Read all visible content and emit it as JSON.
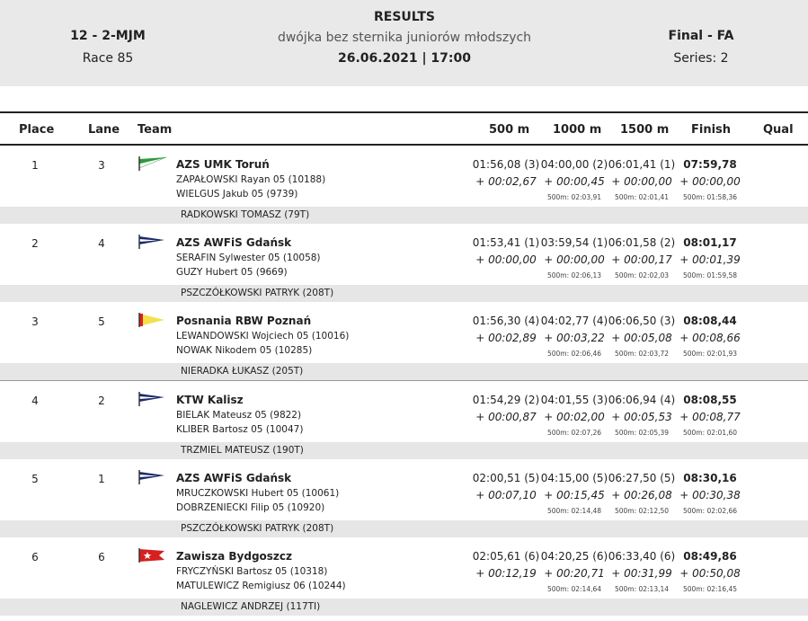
{
  "header": {
    "event_code": "12 - 2-MJM",
    "race": "Race 85",
    "title": "RESULTS",
    "subtitle": "dwójka bez sternika juniorów młodszych",
    "datetime": "26.06.2021 | 17:00",
    "phase": "Final - FA",
    "series": "Series: 2"
  },
  "columns": {
    "place": "Place",
    "lane": "Lane",
    "team": "Team",
    "s500": "500 m",
    "s1000": "1000 m",
    "s1500": "1500 m",
    "finish": "Finish",
    "qual": "Qual"
  },
  "rows": [
    {
      "place": "1",
      "lane": "3",
      "team": "AZS UMK Toruń",
      "rower1": "ZAPAŁOWSKI  Rayan 05 (10188)",
      "rower2": "WIELGUS  Jakub 05 (9739)",
      "cox": "RADKOWSKI TOMASZ (79T)",
      "flag_icon": "flag-green-white-icon",
      "splits": [
        {
          "time": "01:56,08 (3)",
          "delta": "+ 00:02,67",
          "pace": ""
        },
        {
          "time": "04:00,00 (2)",
          "delta": "+ 00:00,45",
          "pace": "500m: 02:03,91"
        },
        {
          "time": "06:01,41 (1)",
          "delta": "+ 00:00,00",
          "pace": "500m: 02:01,41"
        },
        {
          "time": "07:59,78",
          "delta": "+ 00:00,00",
          "pace": "500m: 01:58,36"
        }
      ]
    },
    {
      "place": "2",
      "lane": "4",
      "team": "AZS AWFiS Gdańsk",
      "rower1": "SERAFIN  Sylwester 05 (10058)",
      "rower2": "GUZY  Hubert 05 (9669)",
      "cox": "PSZCZÓŁKOWSKI PATRYK (208T)",
      "flag_icon": "flag-navy-white-icon",
      "splits": [
        {
          "time": "01:53,41 (1)",
          "delta": "+ 00:00,00",
          "pace": ""
        },
        {
          "time": "03:59,54 (1)",
          "delta": "+ 00:00,00",
          "pace": "500m: 02:06,13"
        },
        {
          "time": "06:01,58 (2)",
          "delta": "+ 00:00,17",
          "pace": "500m: 02:02,03"
        },
        {
          "time": "08:01,17",
          "delta": "+ 00:01,39",
          "pace": "500m: 01:59,58"
        }
      ]
    },
    {
      "place": "3",
      "lane": "5",
      "team": "Posnania RBW Poznań",
      "rower1": "LEWANDOWSKI  Wojciech 05 (10016)",
      "rower2": "NOWAK  Nikodem 05 (10285)",
      "cox": "NIERADKA ŁUKASZ (205T)",
      "flag_icon": "flag-yellow-red-icon",
      "splits": [
        {
          "time": "01:56,30 (4)",
          "delta": "+ 00:02,89",
          "pace": ""
        },
        {
          "time": "04:02,77 (4)",
          "delta": "+ 00:03,22",
          "pace": "500m: 02:06,46"
        },
        {
          "time": "06:06,50 (3)",
          "delta": "+ 00:05,08",
          "pace": "500m: 02:03,72"
        },
        {
          "time": "08:08,44",
          "delta": "+ 00:08,66",
          "pace": "500m: 02:01,93"
        }
      ]
    },
    {
      "place": "4",
      "lane": "2",
      "team": "KTW Kalisz",
      "rower1": "BIELAK  Mateusz 05 (9822)",
      "rower2": "KLIBER  Bartosz 05 (10047)",
      "cox": "TRZMIEL MATEUSZ (190T)",
      "flag_icon": "flag-navy-white-icon",
      "splits": [
        {
          "time": "01:54,29 (2)",
          "delta": "+ 00:00,87",
          "pace": ""
        },
        {
          "time": "04:01,55 (3)",
          "delta": "+ 00:02,00",
          "pace": "500m: 02:07,26"
        },
        {
          "time": "06:06,94 (4)",
          "delta": "+ 00:05,53",
          "pace": "500m: 02:05,39"
        },
        {
          "time": "08:08,55",
          "delta": "+ 00:08,77",
          "pace": "500m: 02:01,60"
        }
      ]
    },
    {
      "place": "5",
      "lane": "1",
      "team": "AZS AWFiS Gdańsk",
      "rower1": "MRUCZKOWSKI  Hubert 05 (10061)",
      "rower2": "DOBRZENIECKI  Filip 05 (10920)",
      "cox": "PSZCZÓŁKOWSKI PATRYK (208T)",
      "flag_icon": "flag-navy-white-icon",
      "splits": [
        {
          "time": "02:00,51 (5)",
          "delta": "+ 00:07,10",
          "pace": ""
        },
        {
          "time": "04:15,00 (5)",
          "delta": "+ 00:15,45",
          "pace": "500m: 02:14,48"
        },
        {
          "time": "06:27,50 (5)",
          "delta": "+ 00:26,08",
          "pace": "500m: 02:12,50"
        },
        {
          "time": "08:30,16",
          "delta": "+ 00:30,38",
          "pace": "500m: 02:02,66"
        }
      ]
    },
    {
      "place": "6",
      "lane": "6",
      "team": "Zawisza Bydgoszcz",
      "rower1": "FRYCZYŃSKI  Bartosz 05 (10318)",
      "rower2": "MATULEWICZ  Remigiusz 06 (10244)",
      "cox": "NAGLEWICZ ANDRZEJ (117TI)",
      "flag_icon": "flag-red-white-star-icon",
      "splits": [
        {
          "time": "02:05,61 (6)",
          "delta": "+ 00:12,19",
          "pace": ""
        },
        {
          "time": "04:20,25 (6)",
          "delta": "+ 00:20,71",
          "pace": "500m: 02:14,64"
        },
        {
          "time": "06:33,40 (6)",
          "delta": "+ 00:31,99",
          "pace": "500m: 02:13,14"
        },
        {
          "time": "08:49,86",
          "delta": "+ 00:50,08",
          "pace": "500m: 02:16,45"
        }
      ]
    }
  ]
}
